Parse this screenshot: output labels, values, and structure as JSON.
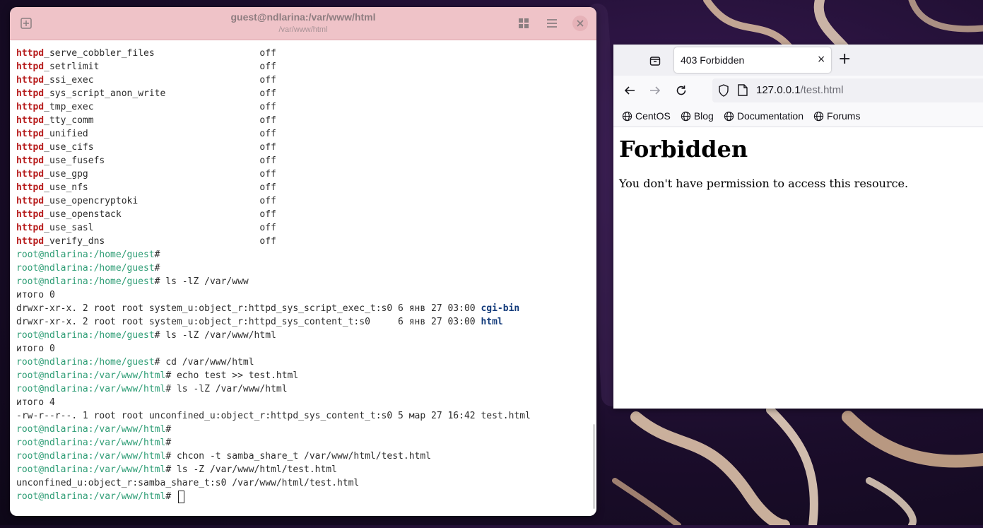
{
  "terminal": {
    "title": "guest@ndlarina:/var/www/html",
    "subtitle": "/var/www/html",
    "icons": {
      "new_tab": "add-tab-icon",
      "grid": "grid-view-icon",
      "menu": "hamburger-menu-icon",
      "close": "close-icon"
    },
    "lines": [
      [
        {
          "t": "httpd",
          "c": "kw"
        },
        {
          "t": "_serve_cobbler_files                   off"
        }
      ],
      [
        {
          "t": "httpd",
          "c": "kw"
        },
        {
          "t": "_setrlimit                             off"
        }
      ],
      [
        {
          "t": "httpd",
          "c": "kw"
        },
        {
          "t": "_ssi_exec                              off"
        }
      ],
      [
        {
          "t": "httpd",
          "c": "kw"
        },
        {
          "t": "_sys_script_anon_write                 off"
        }
      ],
      [
        {
          "t": "httpd",
          "c": "kw"
        },
        {
          "t": "_tmp_exec                              off"
        }
      ],
      [
        {
          "t": "httpd",
          "c": "kw"
        },
        {
          "t": "_tty_comm                              off"
        }
      ],
      [
        {
          "t": "httpd",
          "c": "kw"
        },
        {
          "t": "_unified                               off"
        }
      ],
      [
        {
          "t": "httpd",
          "c": "kw"
        },
        {
          "t": "_use_cifs                              off"
        }
      ],
      [
        {
          "t": "httpd",
          "c": "kw"
        },
        {
          "t": "_use_fusefs                            off"
        }
      ],
      [
        {
          "t": "httpd",
          "c": "kw"
        },
        {
          "t": "_use_gpg                               off"
        }
      ],
      [
        {
          "t": "httpd",
          "c": "kw"
        },
        {
          "t": "_use_nfs                               off"
        }
      ],
      [
        {
          "t": "httpd",
          "c": "kw"
        },
        {
          "t": "_use_opencryptoki                      off"
        }
      ],
      [
        {
          "t": "httpd",
          "c": "kw"
        },
        {
          "t": "_use_openstack                         off"
        }
      ],
      [
        {
          "t": "httpd",
          "c": "kw"
        },
        {
          "t": "_use_sasl                              off"
        }
      ],
      [
        {
          "t": "httpd",
          "c": "kw"
        },
        {
          "t": "_verify_dns                            off"
        }
      ],
      [
        {
          "t": "root@ndlarina:/home/guest",
          "c": "prompt"
        },
        {
          "t": "#"
        }
      ],
      [
        {
          "t": "root@ndlarina:/home/guest",
          "c": "prompt"
        },
        {
          "t": "#"
        }
      ],
      [
        {
          "t": "root@ndlarina:/home/guest",
          "c": "prompt"
        },
        {
          "t": "# ls -lZ /var/www"
        }
      ],
      [
        {
          "t": "итого 0"
        }
      ],
      [
        {
          "t": "drwxr-xr-x. 2 root root system_u:object_r:httpd_sys_script_exec_t:s0 6 янв 27 03:00 "
        },
        {
          "t": "cgi-bin",
          "c": "dir"
        }
      ],
      [
        {
          "t": "drwxr-xr-x. 2 root root system_u:object_r:httpd_sys_content_t:s0     6 янв 27 03:00 "
        },
        {
          "t": "html",
          "c": "dir"
        }
      ],
      [
        {
          "t": "root@ndlarina:/home/guest",
          "c": "prompt"
        },
        {
          "t": "# ls -lZ /var/www/html"
        }
      ],
      [
        {
          "t": "итого 0"
        }
      ],
      [
        {
          "t": "root@ndlarina:/home/guest",
          "c": "prompt"
        },
        {
          "t": "# cd /var/www/html"
        }
      ],
      [
        {
          "t": "root@ndlarina:/var/www/html",
          "c": "prompt"
        },
        {
          "t": "# echo test >> test.html"
        }
      ],
      [
        {
          "t": "root@ndlarina:/var/www/html",
          "c": "prompt"
        },
        {
          "t": "# ls -lZ /var/www/html"
        }
      ],
      [
        {
          "t": "итого 4"
        }
      ],
      [
        {
          "t": "-rw-r--r--. 1 root root unconfined_u:object_r:httpd_sys_content_t:s0 5 мар 27 16:42 test.html"
        }
      ],
      [
        {
          "t": "root@ndlarina:/var/www/html",
          "c": "prompt"
        },
        {
          "t": "#"
        }
      ],
      [
        {
          "t": "root@ndlarina:/var/www/html",
          "c": "prompt"
        },
        {
          "t": "#"
        }
      ],
      [
        {
          "t": "root@ndlarina:/var/www/html",
          "c": "prompt"
        },
        {
          "t": "# chcon -t samba_share_t /var/www/html/test.html"
        }
      ],
      [
        {
          "t": "root@ndlarina:/var/www/html",
          "c": "prompt"
        },
        {
          "t": "# ls -Z /var/www/html/test.html"
        }
      ],
      [
        {
          "t": "unconfined_u:object_r:samba_share_t:s0 /var/www/html/test.html"
        }
      ],
      [
        {
          "t": "root@ndlarina:/var/www/html",
          "c": "prompt"
        },
        {
          "t": "# "
        },
        {
          "t": "",
          "c": "cursor"
        }
      ]
    ]
  },
  "browser": {
    "tab": {
      "title": "403 Forbidden",
      "close": "×"
    },
    "new_tab": "+",
    "url": {
      "host": "127.0.0.1",
      "path": "/test.html"
    },
    "bookmarks": [
      "CentOS",
      "Blog",
      "Documentation",
      "Forums"
    ],
    "page": {
      "heading": "Forbidden",
      "message": "You don't have permission to access this resource."
    }
  },
  "colors": {
    "terminal_header": "#efc3c8",
    "keyword": "#b71c1c",
    "prompt": "#2e9d75",
    "directory": "#123a7a"
  }
}
